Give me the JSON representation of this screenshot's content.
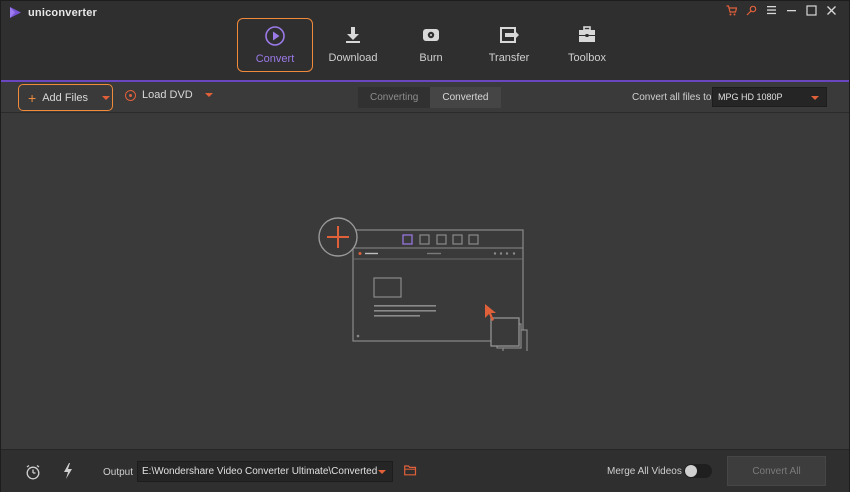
{
  "app": {
    "name": "uniconverter"
  },
  "window_controls": [
    "cart-icon",
    "key-icon",
    "menu-icon",
    "minimize-icon",
    "maximize-icon",
    "close-icon"
  ],
  "tabs": [
    {
      "label": "Convert",
      "icon": "convert-icon",
      "active": true
    },
    {
      "label": "Download",
      "icon": "download-icon",
      "active": false
    },
    {
      "label": "Burn",
      "icon": "burn-icon",
      "active": false
    },
    {
      "label": "Transfer",
      "icon": "transfer-icon",
      "active": false
    },
    {
      "label": "Toolbox",
      "icon": "toolbox-icon",
      "active": false
    }
  ],
  "toolbar": {
    "add_files_label": "Add Files",
    "load_dvd_label": "Load DVD",
    "segment": {
      "converting": "Converting",
      "converted": "Converted",
      "selected": "Converted"
    },
    "convert_all_files_label": "Convert all files to:",
    "format_value": "MPG HD 1080P"
  },
  "bottom": {
    "output_label": "Output",
    "output_path": "E:\\Wondershare Video Converter Ultimate\\Converted",
    "merge_label": "Merge All Videos",
    "merge_enabled": false,
    "convert_all_label": "Convert All"
  },
  "colors": {
    "accent_orange": "#f08a3c",
    "accent_purple": "#6b46c1",
    "active_tab_text": "#9b7ae8",
    "icon_red": "#e0603a"
  }
}
